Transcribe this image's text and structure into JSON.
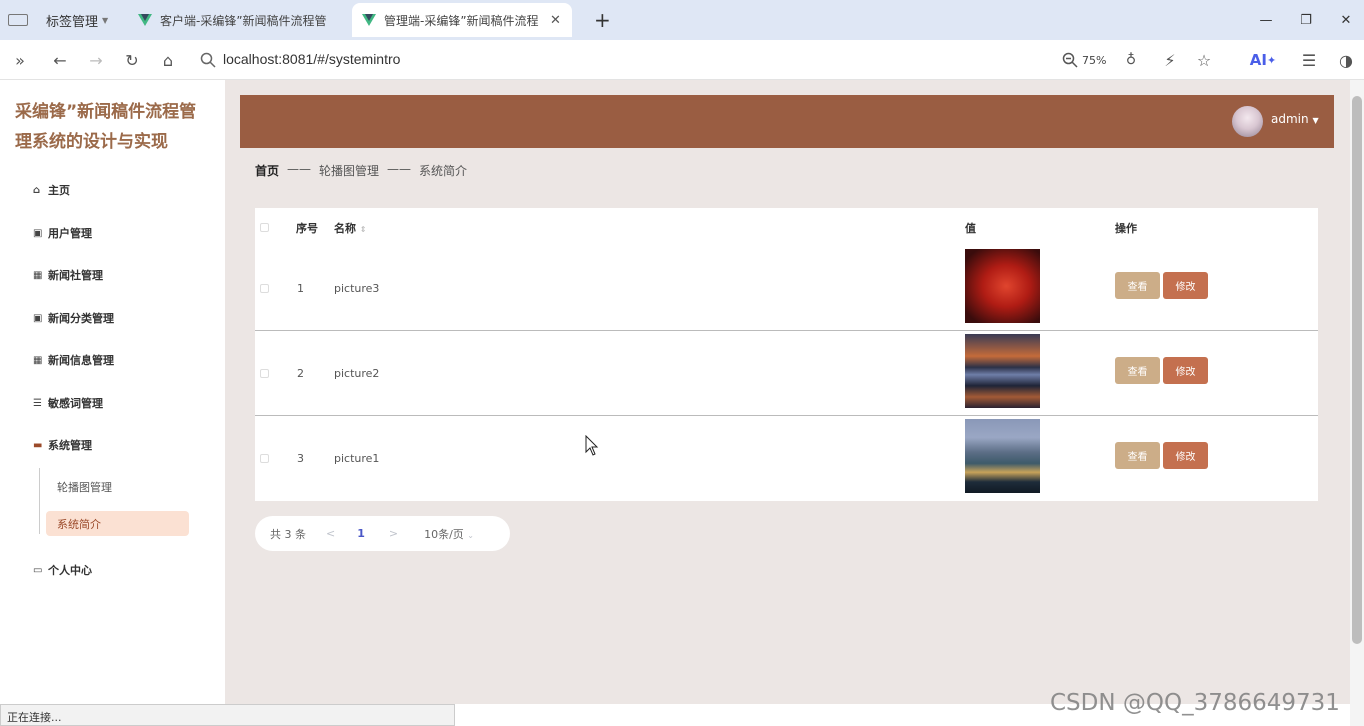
{
  "browser": {
    "tab_group": "标签管理",
    "tabs": [
      {
        "label": "客户端-采编锋”新闻稿件流程管"
      },
      {
        "label": "管理端-采编锋”新闻稿件流程"
      }
    ],
    "new_tab": "+",
    "url": "localhost:8081/#/systemintro",
    "zoom": "75%",
    "ai_label": "AI"
  },
  "sidebar": {
    "title": "采编锋”新闻稿件流程管理系统的设计与实现",
    "menu": [
      {
        "label": "主页"
      },
      {
        "label": "用户管理"
      },
      {
        "label": "新闻社管理"
      },
      {
        "label": "新闻分类管理"
      },
      {
        "label": "新闻信息管理"
      },
      {
        "label": "敏感词管理"
      },
      {
        "label": "系统管理"
      },
      {
        "label": "个人中心"
      }
    ],
    "submenu": [
      {
        "label": "轮播图管理"
      },
      {
        "label": "系统简介"
      }
    ]
  },
  "header": {
    "username": "admin"
  },
  "breadcrumb": {
    "home": "首页",
    "sep": "——",
    "level1": "轮播图管理",
    "level2": "系统简介"
  },
  "table": {
    "headers": {
      "index": "序号",
      "name": "名称",
      "value": "值",
      "ops": "操作"
    },
    "rows": [
      {
        "index": "1",
        "name": "picture3"
      },
      {
        "index": "2",
        "name": "picture2"
      },
      {
        "index": "3",
        "name": "picture1"
      }
    ],
    "view_label": "查看",
    "edit_label": "修改"
  },
  "pagination": {
    "total": "共 3 条",
    "prev": "<",
    "page": "1",
    "next": ">",
    "page_size": "10条/页"
  },
  "status_bar": "正在连接...",
  "watermark": "CSDN @QQ_3786649731"
}
